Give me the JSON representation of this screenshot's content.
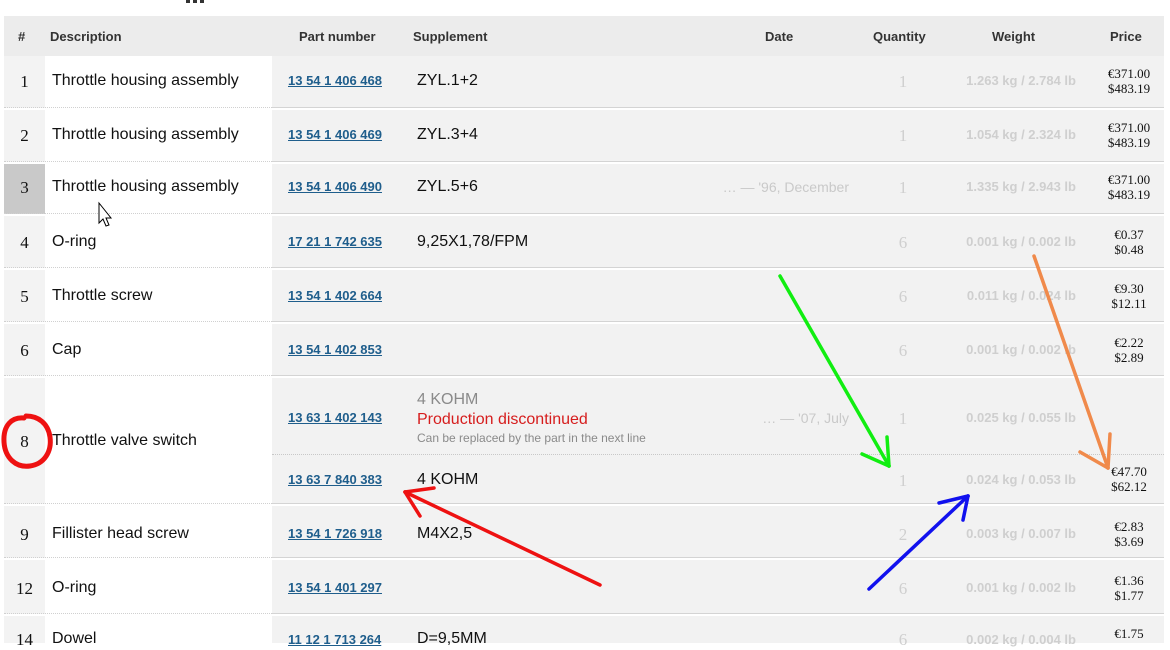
{
  "header": {
    "num": "#",
    "description": "Description",
    "part_number": "Part number",
    "supplement": "Supplement",
    "date": "Date",
    "quantity": "Quantity",
    "weight": "Weight",
    "price": "Price"
  },
  "rows": [
    {
      "num": "1",
      "description": "Throttle housing assembly",
      "part": "13 54 1 406 468",
      "supplement": "ZYL.1+2",
      "date": "",
      "qty": "1",
      "weight": "1.263 kg / 2.784 lb",
      "price_eur": "€371.00",
      "price_usd": "$483.19"
    },
    {
      "num": "2",
      "description": "Throttle housing assembly",
      "part": "13 54 1 406 469",
      "supplement": "ZYL.3+4",
      "date": "",
      "qty": "1",
      "weight": "1.054 kg / 2.324 lb",
      "price_eur": "€371.00",
      "price_usd": "$483.19"
    },
    {
      "num": "3",
      "description": "Throttle housing assembly",
      "part": "13 54 1 406 490",
      "supplement": "ZYL.5+6",
      "date": "… — '96, December",
      "qty": "1",
      "weight": "1.335 kg / 2.943 lb",
      "price_eur": "€371.00",
      "price_usd": "$483.19"
    },
    {
      "num": "4",
      "description": "O-ring",
      "part": "17 21 1 742 635",
      "supplement": "9,25X1,78/FPM",
      "date": "",
      "qty": "6",
      "weight": "0.001 kg / 0.002 lb",
      "price_eur": "€0.37",
      "price_usd": "$0.48"
    },
    {
      "num": "5",
      "description": "Throttle screw",
      "part": "13 54 1 402 664",
      "supplement": "",
      "date": "",
      "qty": "6",
      "weight": "0.011 kg / 0.024 lb",
      "price_eur": "€9.30",
      "price_usd": "$12.11"
    },
    {
      "num": "6",
      "description": "Cap",
      "part": "13 54 1 402 853",
      "supplement": "",
      "date": "",
      "qty": "6",
      "weight": "0.001 kg / 0.002 lb",
      "price_eur": "€2.22",
      "price_usd": "$2.89"
    },
    {
      "num": "8",
      "description": "Throttle valve switch",
      "sub_a": {
        "part": "13 63 1 402 143",
        "supp_line1": "4 KOHM",
        "supp_line2": "Production discontinued",
        "supp_line3": "Can be replaced by the part in the next line",
        "date": "… — '07, July",
        "qty": "1",
        "weight": "0.025 kg / 0.055 lb"
      },
      "sub_b": {
        "part": "13 63 7 840 383",
        "supplement": "4 KOHM",
        "qty": "1",
        "weight": "0.024 kg / 0.053 lb",
        "price_eur": "€47.70",
        "price_usd": "$62.12"
      }
    },
    {
      "num": "9",
      "description": "Fillister head screw",
      "part": "13 54 1 726 918",
      "supplement": "M4X2,5",
      "date": "",
      "qty": "2",
      "weight": "0.003 kg / 0.007 lb",
      "price_eur": "€2.83",
      "price_usd": "$3.69"
    },
    {
      "num": "12",
      "description": "O-ring",
      "part": "13 54 1 401 297",
      "supplement": "",
      "date": "",
      "qty": "6",
      "weight": "0.001 kg / 0.002 lb",
      "price_eur": "€1.36",
      "price_usd": "$1.77"
    },
    {
      "num": "14",
      "description": "Dowel",
      "part": "11 12 1 713 264",
      "supplement": "D=9,5MM",
      "date": "",
      "qty": "6",
      "weight": "0.002 kg / 0.004 lb",
      "price_eur": "€1.75",
      "price_usd": ""
    }
  ],
  "annotation_colors": {
    "circle": "#ee1111",
    "red_arrow": "#ee1111",
    "green_arrow": "#11ee11",
    "blue_arrow": "#1111ee",
    "orange_arrow": "#f08a4b"
  }
}
